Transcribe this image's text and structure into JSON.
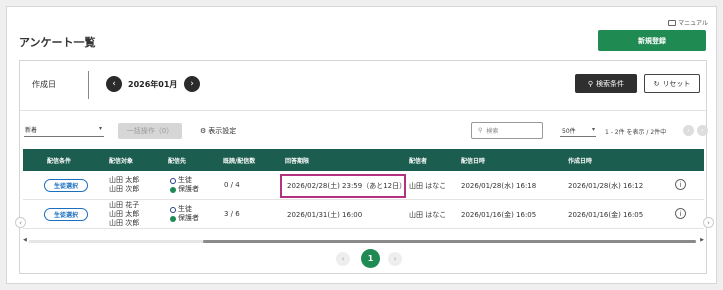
{
  "header": {
    "manual_label": "マニュアル",
    "title": "アンケート一覧",
    "new_button": "新規登録"
  },
  "filter": {
    "date_label": "作成日",
    "month": "2026年01月",
    "search_conditions": "検索条件",
    "reset": "リセット"
  },
  "toolbar": {
    "sort_value": "新着",
    "bulk_action": "一括操作（0）",
    "display_settings": "表示設定",
    "search_placeholder": "検索",
    "per_page": "50件",
    "count_text": "1 - 2件 を表示 / 2件中"
  },
  "table": {
    "columns": [
      "配信条件",
      "配信対象",
      "配信先",
      "既読/配信数",
      "回答期限",
      "配信者",
      "配信日時",
      "作成日時"
    ],
    "rows": [
      {
        "condition": "生徒選択",
        "targets": [
          "山田 太郎",
          "山田 次郎"
        ],
        "dest_student": "生徒",
        "dest_guardian": "保護者",
        "read_count": "0 / 4",
        "deadline": "2026/02/28(土) 23:59（あと12日）",
        "sender": "山田 はなこ",
        "sent_at": "2026/01/28(水) 16:18",
        "created_at": "2026/01/28(水) 16:12"
      },
      {
        "condition": "生徒選択",
        "targets": [
          "山田 花子",
          "山田 太郎",
          "山田 次郎"
        ],
        "dest_student": "生徒",
        "dest_guardian": "保護者",
        "read_count": "3 / 6",
        "deadline": "2026/01/31(土) 16:00",
        "sender": "山田 はなこ",
        "sent_at": "2026/01/16(金) 16:05",
        "created_at": "2026/01/16(金) 16:05"
      }
    ]
  },
  "pagination": {
    "current": "1"
  },
  "colors": {
    "brand_green": "#1f8a52",
    "header_teal": "#1b5d4e",
    "highlight": "#b3327f",
    "badge_blue": "#1a6fbf"
  }
}
